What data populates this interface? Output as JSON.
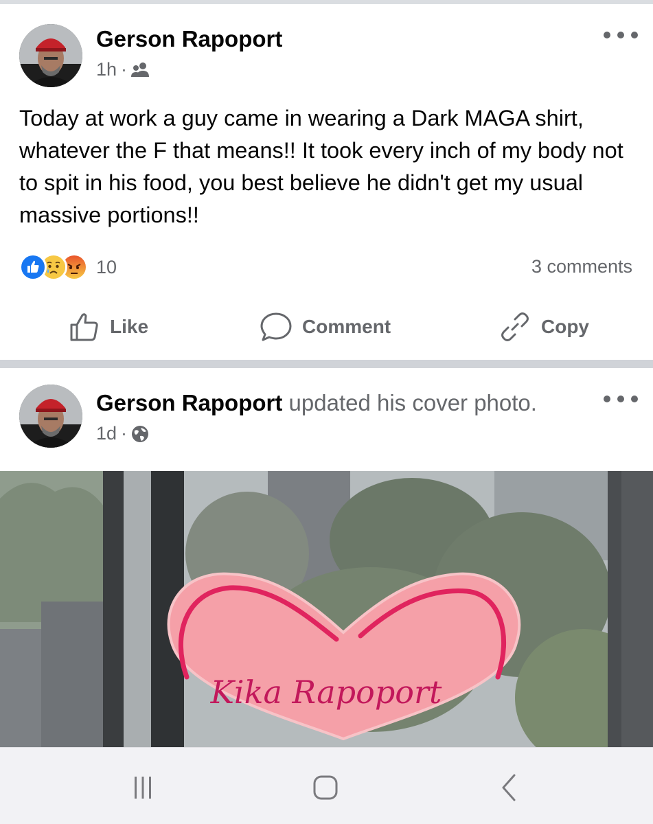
{
  "posts": [
    {
      "author": "Gerson Rapoport",
      "action": "",
      "time": "1h",
      "audience_icon": "friends-icon",
      "text": "Today at work a guy came in wearing a Dark MAGA shirt, whatever the F that means!! It took every inch of my body not to spit in his food, you best believe he didn't get my usual massive portions!!",
      "reactions": [
        "like",
        "sad",
        "angry"
      ],
      "reaction_count": "10",
      "comments": "3 comments",
      "buttons": {
        "like": "Like",
        "comment": "Comment",
        "copy": "Copy"
      }
    },
    {
      "author": "Gerson Rapoport",
      "action": "updated his cover photo.",
      "time": "1d",
      "audience_icon": "globe-icon",
      "photo_caption": "Kika Rapoport"
    }
  ],
  "navbar": {
    "buttons": [
      "recent-apps",
      "home",
      "back"
    ]
  },
  "colors": {
    "like_blue": "#1877f2",
    "secondary_text": "#65676b",
    "separator": "#d0d3d8",
    "heart_fill": "#f5a0a8",
    "heart_outline": "#e0245e"
  }
}
